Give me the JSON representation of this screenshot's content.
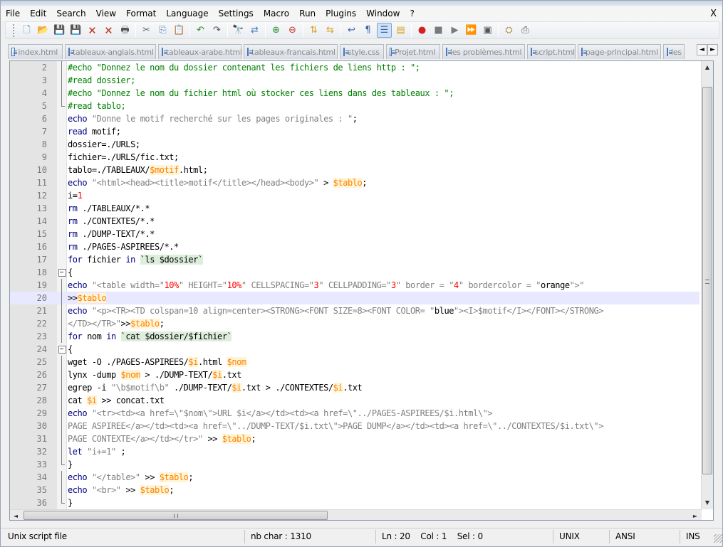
{
  "menu": [
    "File",
    "Edit",
    "Search",
    "View",
    "Format",
    "Language",
    "Settings",
    "Macro",
    "Run",
    "Plugins",
    "Window",
    "?"
  ],
  "close_doc_label": "X",
  "toolbar": [
    {
      "name": "new-file-icon",
      "glyph": "🗋",
      "color": "#4a7fc0"
    },
    {
      "name": "open-file-icon",
      "glyph": "📂",
      "color": "#d9a323"
    },
    {
      "name": "save-icon",
      "glyph": "💾",
      "color": "#3a67a8"
    },
    {
      "name": "save-all-icon",
      "glyph": "💾",
      "color": "#3a67a8"
    },
    {
      "name": "close-icon",
      "glyph": "🗙",
      "color": "#c0392b"
    },
    {
      "name": "close-all-icon",
      "glyph": "🗙",
      "color": "#c0392b"
    },
    {
      "name": "print-icon",
      "glyph": "🖶",
      "color": "#555555"
    },
    {
      "sep": true
    },
    {
      "name": "cut-icon",
      "glyph": "✂",
      "color": "#606060"
    },
    {
      "name": "copy-icon",
      "glyph": "⎘",
      "color": "#4a7fc0"
    },
    {
      "name": "paste-icon",
      "glyph": "📋",
      "color": "#b58b3a"
    },
    {
      "sep": true
    },
    {
      "name": "undo-icon",
      "glyph": "↶",
      "color": "#2f8f2f"
    },
    {
      "name": "redo-icon",
      "glyph": "↷",
      "color": "#555555"
    },
    {
      "sep": true
    },
    {
      "name": "find-icon",
      "glyph": "🔭",
      "color": "#333333"
    },
    {
      "name": "replace-icon",
      "glyph": "⇄",
      "color": "#4a7fc0"
    },
    {
      "sep": true
    },
    {
      "name": "zoom-in-icon",
      "glyph": "⊕",
      "color": "#2f8f2f"
    },
    {
      "name": "zoom-out-icon",
      "glyph": "⊖",
      "color": "#c0392b"
    },
    {
      "sep": true
    },
    {
      "name": "sync-vertical-icon",
      "glyph": "⇅",
      "color": "#d9a323"
    },
    {
      "name": "sync-horizontal-icon",
      "glyph": "⇆",
      "color": "#d9a323"
    },
    {
      "sep": true
    },
    {
      "name": "word-wrap-icon",
      "glyph": "↩",
      "color": "#3a67a8"
    },
    {
      "name": "show-all-chars-icon",
      "glyph": "¶",
      "color": "#3a67a8"
    },
    {
      "name": "indent-guide-icon",
      "glyph": "☰",
      "color": "#3a67a8",
      "active": true
    },
    {
      "name": "user-language-icon",
      "glyph": "▤",
      "color": "#d9a323"
    },
    {
      "sep": true
    },
    {
      "name": "record-macro-icon",
      "glyph": "●",
      "color": "#d62020"
    },
    {
      "name": "stop-record-icon",
      "glyph": "■",
      "color": "#7a7a7a"
    },
    {
      "name": "play-macro-icon",
      "glyph": "▶",
      "color": "#7a7a7a"
    },
    {
      "name": "play-multiple-icon",
      "glyph": "⏩",
      "color": "#3a67a8"
    },
    {
      "name": "save-macro-icon",
      "glyph": "▣",
      "color": "#555555"
    },
    {
      "sep": true
    },
    {
      "name": "plugin-a-icon",
      "glyph": "⛭",
      "color": "#b58b3a"
    },
    {
      "name": "plugin-b-icon",
      "glyph": "⎙",
      "color": "#555555"
    }
  ],
  "tabs": [
    {
      "label": "index.html",
      "width": 77
    },
    {
      "label": "tableaux-anglais.html",
      "width": 128
    },
    {
      "label": "tableaux-arabe.html",
      "width": 117
    },
    {
      "label": "tableaux-francais.html",
      "width": 132
    },
    {
      "label": "style.css",
      "width": 62
    },
    {
      "label": "Projet.html",
      "width": 76
    },
    {
      "label": "les problèmes.html",
      "width": 116
    },
    {
      "label": "script.html",
      "width": 68
    },
    {
      "label": "page-principal.html",
      "width": 117
    },
    {
      "label": "les",
      "width": 30
    }
  ],
  "tab_scroll_left": "◄",
  "tab_scroll_right": "►",
  "code_lines": [
    {
      "n": "2",
      "fold": "vline",
      "t": [
        [
          "#echo \"Donnez le nom du dossier contenant les fichiers de liens http : \";",
          "cmt"
        ]
      ]
    },
    {
      "n": "3",
      "fold": "vline",
      "t": [
        [
          "#read dossier;",
          "cmt"
        ]
      ]
    },
    {
      "n": "4",
      "fold": "vline",
      "t": [
        [
          "#echo \"Donnez le nom du fichier html où stocker ces liens dans des tableaux : \";",
          "cmt"
        ]
      ]
    },
    {
      "n": "5",
      "fold": "end",
      "t": [
        [
          "#read tablo;",
          "cmt"
        ]
      ]
    },
    {
      "n": "6",
      "t": [
        [
          "echo",
          "kw"
        ],
        [
          " ",
          ""
        ],
        [
          "\"Donne le motif recherché sur les pages originales : \"",
          "str"
        ],
        [
          ";",
          ""
        ]
      ]
    },
    {
      "n": "7",
      "t": [
        [
          "read",
          "kw"
        ],
        [
          " motif;",
          ""
        ]
      ]
    },
    {
      "n": "8",
      "t": [
        [
          "dossier=./URLS;",
          ""
        ]
      ]
    },
    {
      "n": "9",
      "t": [
        [
          "fichier=./URLS/fic.txt;",
          ""
        ]
      ]
    },
    {
      "n": "10",
      "t": [
        [
          "tablo=./TABLEAUX/",
          ""
        ],
        [
          "$motif",
          "var"
        ],
        [
          ".html;",
          ""
        ]
      ]
    },
    {
      "n": "11",
      "t": [
        [
          "echo",
          "kw"
        ],
        [
          " ",
          ""
        ],
        [
          "\"<html><head><title>motif</title></head><body>\"",
          "str"
        ],
        [
          " > ",
          ""
        ],
        [
          "$tablo",
          "var"
        ],
        [
          ";",
          ""
        ]
      ]
    },
    {
      "n": "12",
      "t": [
        [
          "i=",
          ""
        ],
        [
          "1",
          "num"
        ]
      ]
    },
    {
      "n": "13",
      "t": [
        [
          "rm",
          "kw"
        ],
        [
          " ./TABLEAUX/*.*",
          ""
        ]
      ]
    },
    {
      "n": "14",
      "t": [
        [
          "rm",
          "kw"
        ],
        [
          " ./CONTEXTES/*.*",
          ""
        ]
      ]
    },
    {
      "n": "15",
      "t": [
        [
          "rm",
          "kw"
        ],
        [
          " ./DUMP-TEXT/*.*",
          ""
        ]
      ]
    },
    {
      "n": "16",
      "t": [
        [
          "rm",
          "kw"
        ],
        [
          " ./PAGES-ASPIREES/*.*",
          ""
        ]
      ]
    },
    {
      "n": "17",
      "t": [
        [
          "for",
          "kw"
        ],
        [
          " fichier ",
          ""
        ],
        [
          "in",
          "kw"
        ],
        [
          " ",
          ""
        ],
        [
          "`ls $dossier`",
          "bq"
        ]
      ]
    },
    {
      "n": "18",
      "fold": "box",
      "t": [
        [
          "{",
          ""
        ]
      ]
    },
    {
      "n": "19",
      "fold": "vline",
      "t": [
        [
          "echo",
          "kw"
        ],
        [
          " ",
          ""
        ],
        [
          "\"<table width=\"",
          "str"
        ],
        [
          "10%",
          "num"
        ],
        [
          "\" HEIGHT=\"",
          "str"
        ],
        [
          "10%",
          "num"
        ],
        [
          "\" CELLSPACING=\"",
          "str"
        ],
        [
          "3",
          "num"
        ],
        [
          "\" CELLPADDING=\"",
          "str"
        ],
        [
          "3",
          "num"
        ],
        [
          "\" border = \"",
          "str"
        ],
        [
          "4",
          "num"
        ],
        [
          "\" bordercolor = \"",
          "str"
        ],
        [
          "orange",
          "op"
        ],
        [
          "\">\"",
          "str"
        ]
      ]
    },
    {
      "n": "20",
      "fold": "vline",
      "current": true,
      "t": [
        [
          ">>",
          ""
        ],
        [
          "$tablo",
          "var"
        ]
      ]
    },
    {
      "n": "21",
      "fold": "vline",
      "t": [
        [
          "echo",
          "kw"
        ],
        [
          " ",
          ""
        ],
        [
          "\"<p><TR><TD colspan=10 align=center><STRONG><FONT SIZE=8><FONT COLOR= \"",
          "str"
        ],
        [
          "blue",
          "op"
        ],
        [
          "\"><I>$motif</I></FONT></STRONG>",
          "str"
        ]
      ]
    },
    {
      "n": "22",
      "fold": "vline",
      "t": [
        [
          "</TD></TR>\"",
          "str"
        ],
        [
          ">>",
          ""
        ],
        [
          "$tablo",
          "var"
        ],
        [
          ";",
          ""
        ]
      ]
    },
    {
      "n": "23",
      "fold": "vline",
      "t": [
        [
          "for",
          "kw"
        ],
        [
          " nom ",
          ""
        ],
        [
          "in",
          "kw"
        ],
        [
          " ",
          ""
        ],
        [
          "`cat $dossier/$fichier`",
          "bq"
        ]
      ]
    },
    {
      "n": "24",
      "fold": "box",
      "t": [
        [
          "{",
          ""
        ]
      ]
    },
    {
      "n": "25",
      "fold": "vline",
      "t": [
        [
          "wget -O ./PAGES-ASPIREES/",
          ""
        ],
        [
          "$i",
          "var"
        ],
        [
          ".html ",
          ""
        ],
        [
          "$nom",
          "var"
        ]
      ]
    },
    {
      "n": "26",
      "fold": "vline",
      "t": [
        [
          "lynx -dump ",
          ""
        ],
        [
          "$nom",
          "var"
        ],
        [
          " > ./DUMP-TEXT/",
          ""
        ],
        [
          "$i",
          "var"
        ],
        [
          ".txt",
          ""
        ]
      ]
    },
    {
      "n": "27",
      "fold": "vline",
      "t": [
        [
          "egrep -i ",
          ""
        ],
        [
          "\"\\b$motif\\b\"",
          "str"
        ],
        [
          " ./DUMP-TEXT/",
          ""
        ],
        [
          "$i",
          "var"
        ],
        [
          ".txt > ./CONTEXTES/",
          ""
        ],
        [
          "$i",
          "var"
        ],
        [
          ".txt",
          ""
        ]
      ]
    },
    {
      "n": "28",
      "fold": "vline",
      "t": [
        [
          "cat ",
          ""
        ],
        [
          "$i",
          "var"
        ],
        [
          " >> concat.txt",
          ""
        ]
      ]
    },
    {
      "n": "29",
      "fold": "vline",
      "t": [
        [
          "echo",
          "kw"
        ],
        [
          " ",
          ""
        ],
        [
          "\"<tr><td><a href=\\\"$nom\\\">URL $i</a></td><td><a href=\\\"../PAGES-ASPIREES/$i.html\\\">",
          "str"
        ]
      ]
    },
    {
      "n": "30",
      "fold": "vline",
      "t": [
        [
          "PAGE ASPIREE</a></td><td><a href=\\\"../DUMP-TEXT/$i.txt\\\">PAGE DUMP</a></td><td><a href=\\\"../CONTEXTES/$i.txt\\\">",
          "str"
        ]
      ]
    },
    {
      "n": "31",
      "fold": "vline",
      "t": [
        [
          "PAGE CONTEXTE</a></td></tr>\"",
          "str"
        ],
        [
          " >> ",
          ""
        ],
        [
          "$tablo",
          "var"
        ],
        [
          ";",
          ""
        ]
      ]
    },
    {
      "n": "32",
      "fold": "vline",
      "t": [
        [
          "let",
          "kw"
        ],
        [
          " ",
          ""
        ],
        [
          "\"i+=1\"",
          "str"
        ],
        [
          " ;",
          ""
        ]
      ]
    },
    {
      "n": "33",
      "fold": "end",
      "t": [
        [
          "}",
          ""
        ]
      ]
    },
    {
      "n": "34",
      "fold": "vline",
      "t": [
        [
          "echo",
          "kw"
        ],
        [
          " ",
          ""
        ],
        [
          "\"</table>\"",
          "str"
        ],
        [
          " >> ",
          ""
        ],
        [
          "$tablo",
          "var"
        ],
        [
          ";",
          ""
        ]
      ]
    },
    {
      "n": "35",
      "fold": "vline",
      "t": [
        [
          "echo",
          "kw"
        ],
        [
          " ",
          ""
        ],
        [
          "\"<br>\"",
          "str"
        ],
        [
          " >> ",
          ""
        ],
        [
          "$tablo",
          "var"
        ],
        [
          ";",
          ""
        ]
      ]
    },
    {
      "n": "36",
      "fold": "end",
      "t": [
        [
          "}",
          ""
        ]
      ]
    }
  ],
  "scroll": {
    "up": "▲",
    "down": "▼",
    "left": "◄",
    "right": "►",
    "grip": "|||"
  },
  "status": {
    "file_type": "Unix script file",
    "char_count": "nb char : 1310",
    "position": "Ln : 20    Col : 1    Sel : 0",
    "eol": "UNIX",
    "encoding": "ANSI",
    "mode": "INS"
  }
}
